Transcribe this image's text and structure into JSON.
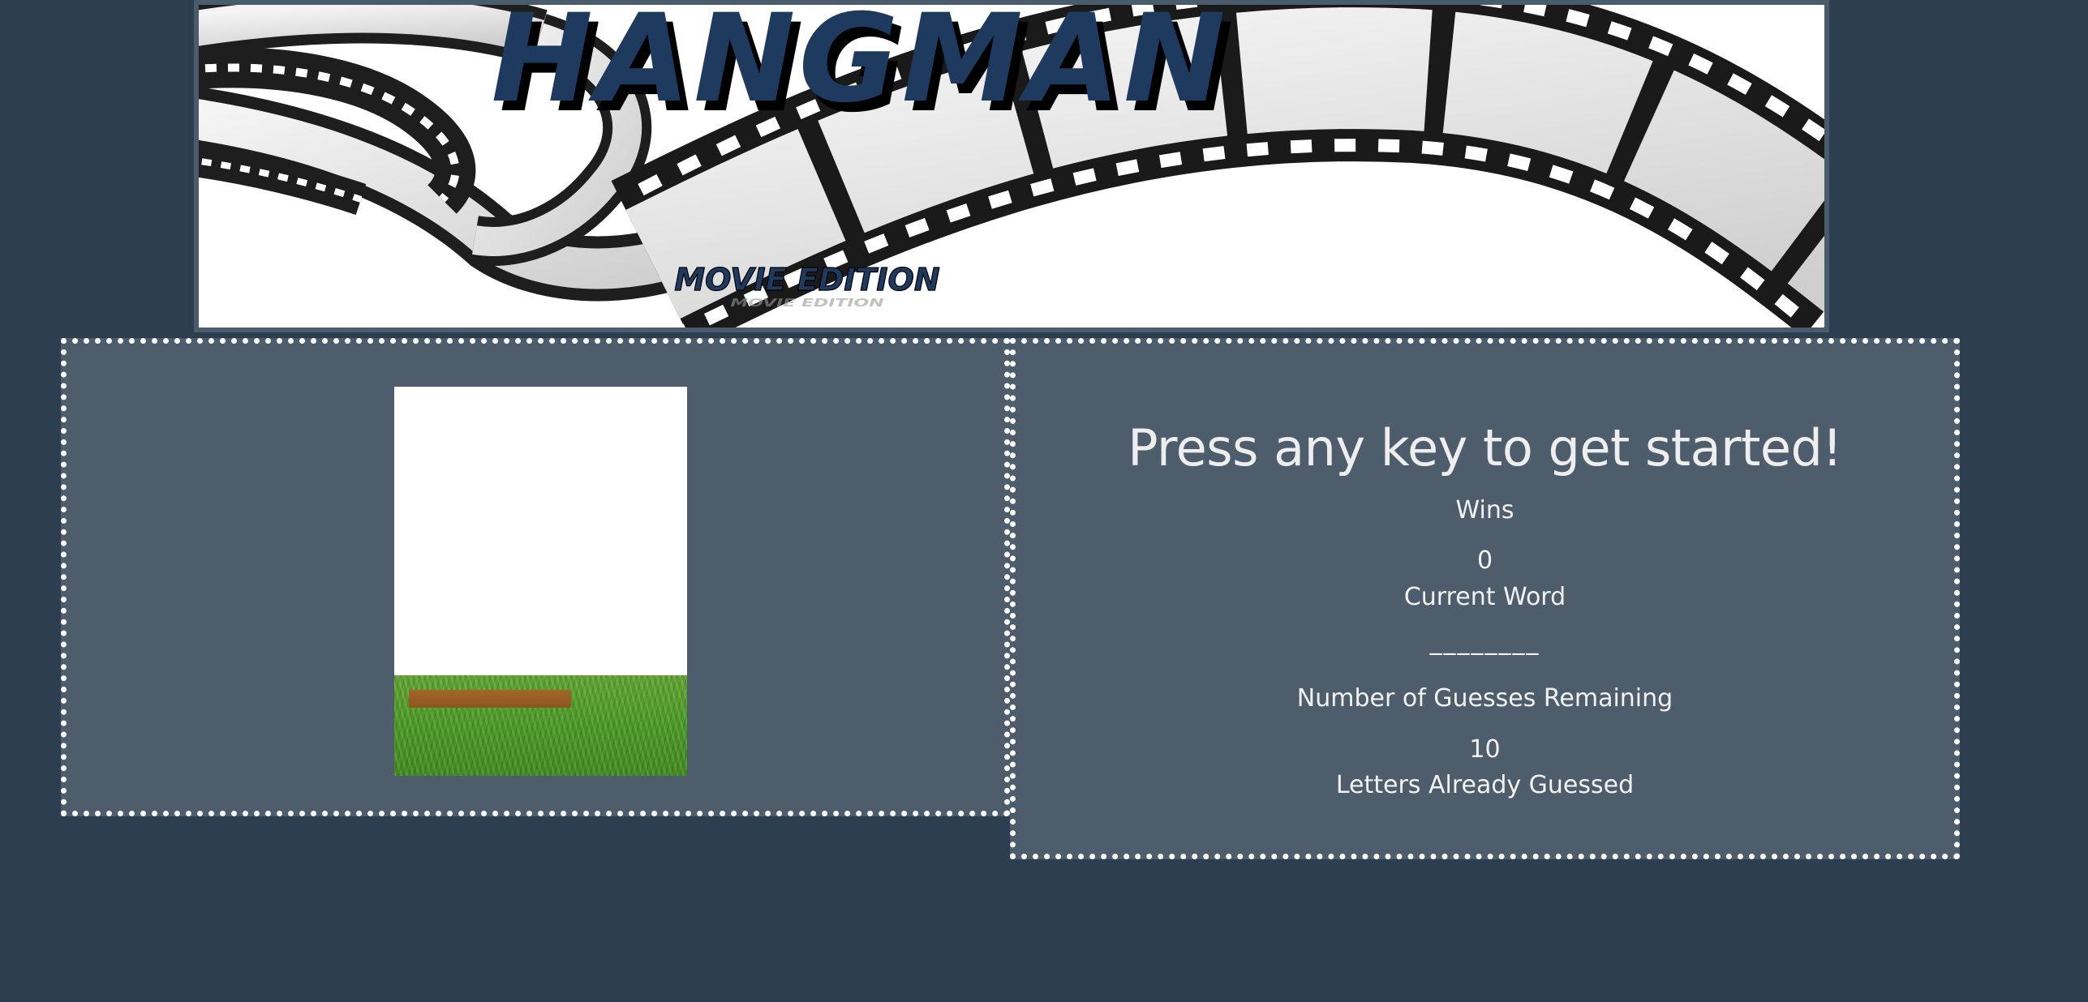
{
  "banner": {
    "title": "HANGMAN",
    "subtitle": "MOVIE EDITION",
    "image": "film-strip-banner"
  },
  "game": {
    "prompt": "Press any key to get started!",
    "wins_label": "Wins",
    "wins_value": "0",
    "current_word_label": "Current Word",
    "current_word_value": "________",
    "guesses_label": "Number of Guesses Remaining",
    "guesses_value": "10",
    "letters_label": "Letters Already Guessed",
    "letters_value": ""
  },
  "hangman_image": "gallows-grass-plank",
  "colors": {
    "background": "#2c3e50",
    "panel": "#4e5d6c",
    "panel_border": "#ffffff",
    "title": "#1e3a5f",
    "text": "#f2f2f2"
  }
}
